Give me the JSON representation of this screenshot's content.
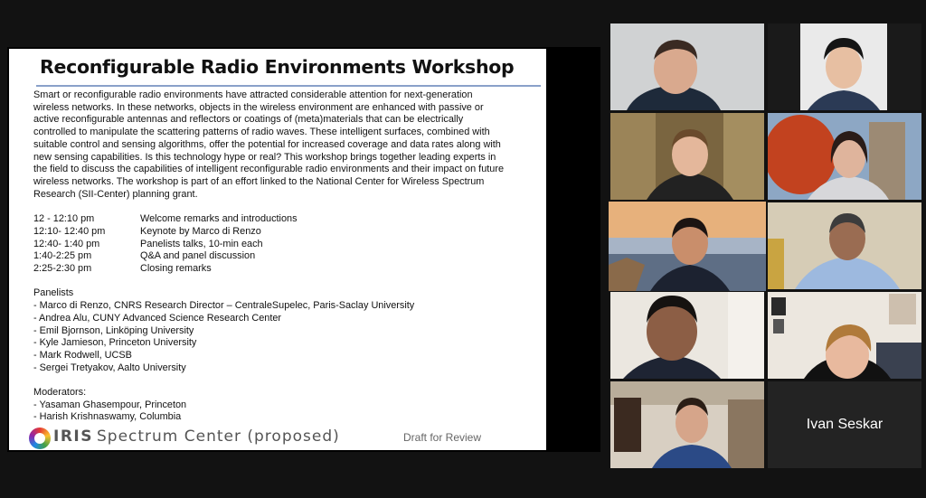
{
  "slide": {
    "title": "Reconfigurable Radio Environments Workshop",
    "intro_lines": [
      "Smart or reconfigurable radio environments have attracted considerable attention for next-generation",
      "wireless networks. In these networks, objects in the wireless environment are enhanced with passive or",
      "active reconfigurable antennas and reflectors or coatings of (meta)materials that can be electrically",
      "controlled to manipulate the scattering patterns of radio waves. These intelligent surfaces, combined with",
      "suitable control and sensing algorithms, offer the potential for increased coverage and data rates along with",
      "new sensing capabilities. Is this technology hype or real? This workshop brings together leading experts in",
      "the field to discuss the capabilities of intelligent reconfigurable radio environments and their impact on future",
      "wireless networks. The workshop is part of an effort linked to the National Center for Wireless Spectrum",
      "Research (SII-Center) planning grant."
    ],
    "schedule": [
      {
        "time": "12 - 12:10 pm",
        "desc": "Welcome remarks and introductions"
      },
      {
        "time": "12:10- 12:40 pm",
        "desc": "Keynote by Marco di Renzo"
      },
      {
        "time": "12:40- 1:40 pm",
        "desc": "Panelists talks, 10-min each"
      },
      {
        "time": "1:40-2:25 pm",
        "desc": "Q&A and panel discussion"
      },
      {
        "time": "2:25-2:30 pm",
        "desc": "Closing remarks"
      }
    ],
    "panelists_heading": "Panelists",
    "panelists": [
      "- Marco di Renzo, CNRS Research Director – CentraleSupelec, Paris-Saclay University",
      "- Andrea Alu, CUNY Advanced Science Research Center",
      "- Emil Bjornson, Linköping University",
      "- Kyle Jamieson, Princeton University",
      "- Mark Rodwell, UCSB",
      "- Sergei Tretyakov, Aalto University"
    ],
    "moderators_heading": "Moderators:",
    "moderators": [
      "- Yasaman Ghasempour, Princeton",
      "- Harish Krishnaswamy, Columbia"
    ],
    "logo_brand": "IRIS",
    "logo_tagline": "Spectrum Center (proposed)",
    "draft_label": "Draft for Review"
  },
  "participants": {
    "name_only_tile": "Ivan Seskar"
  },
  "colors": {
    "active_speaker": "#d8d86a",
    "background": "#121212"
  }
}
